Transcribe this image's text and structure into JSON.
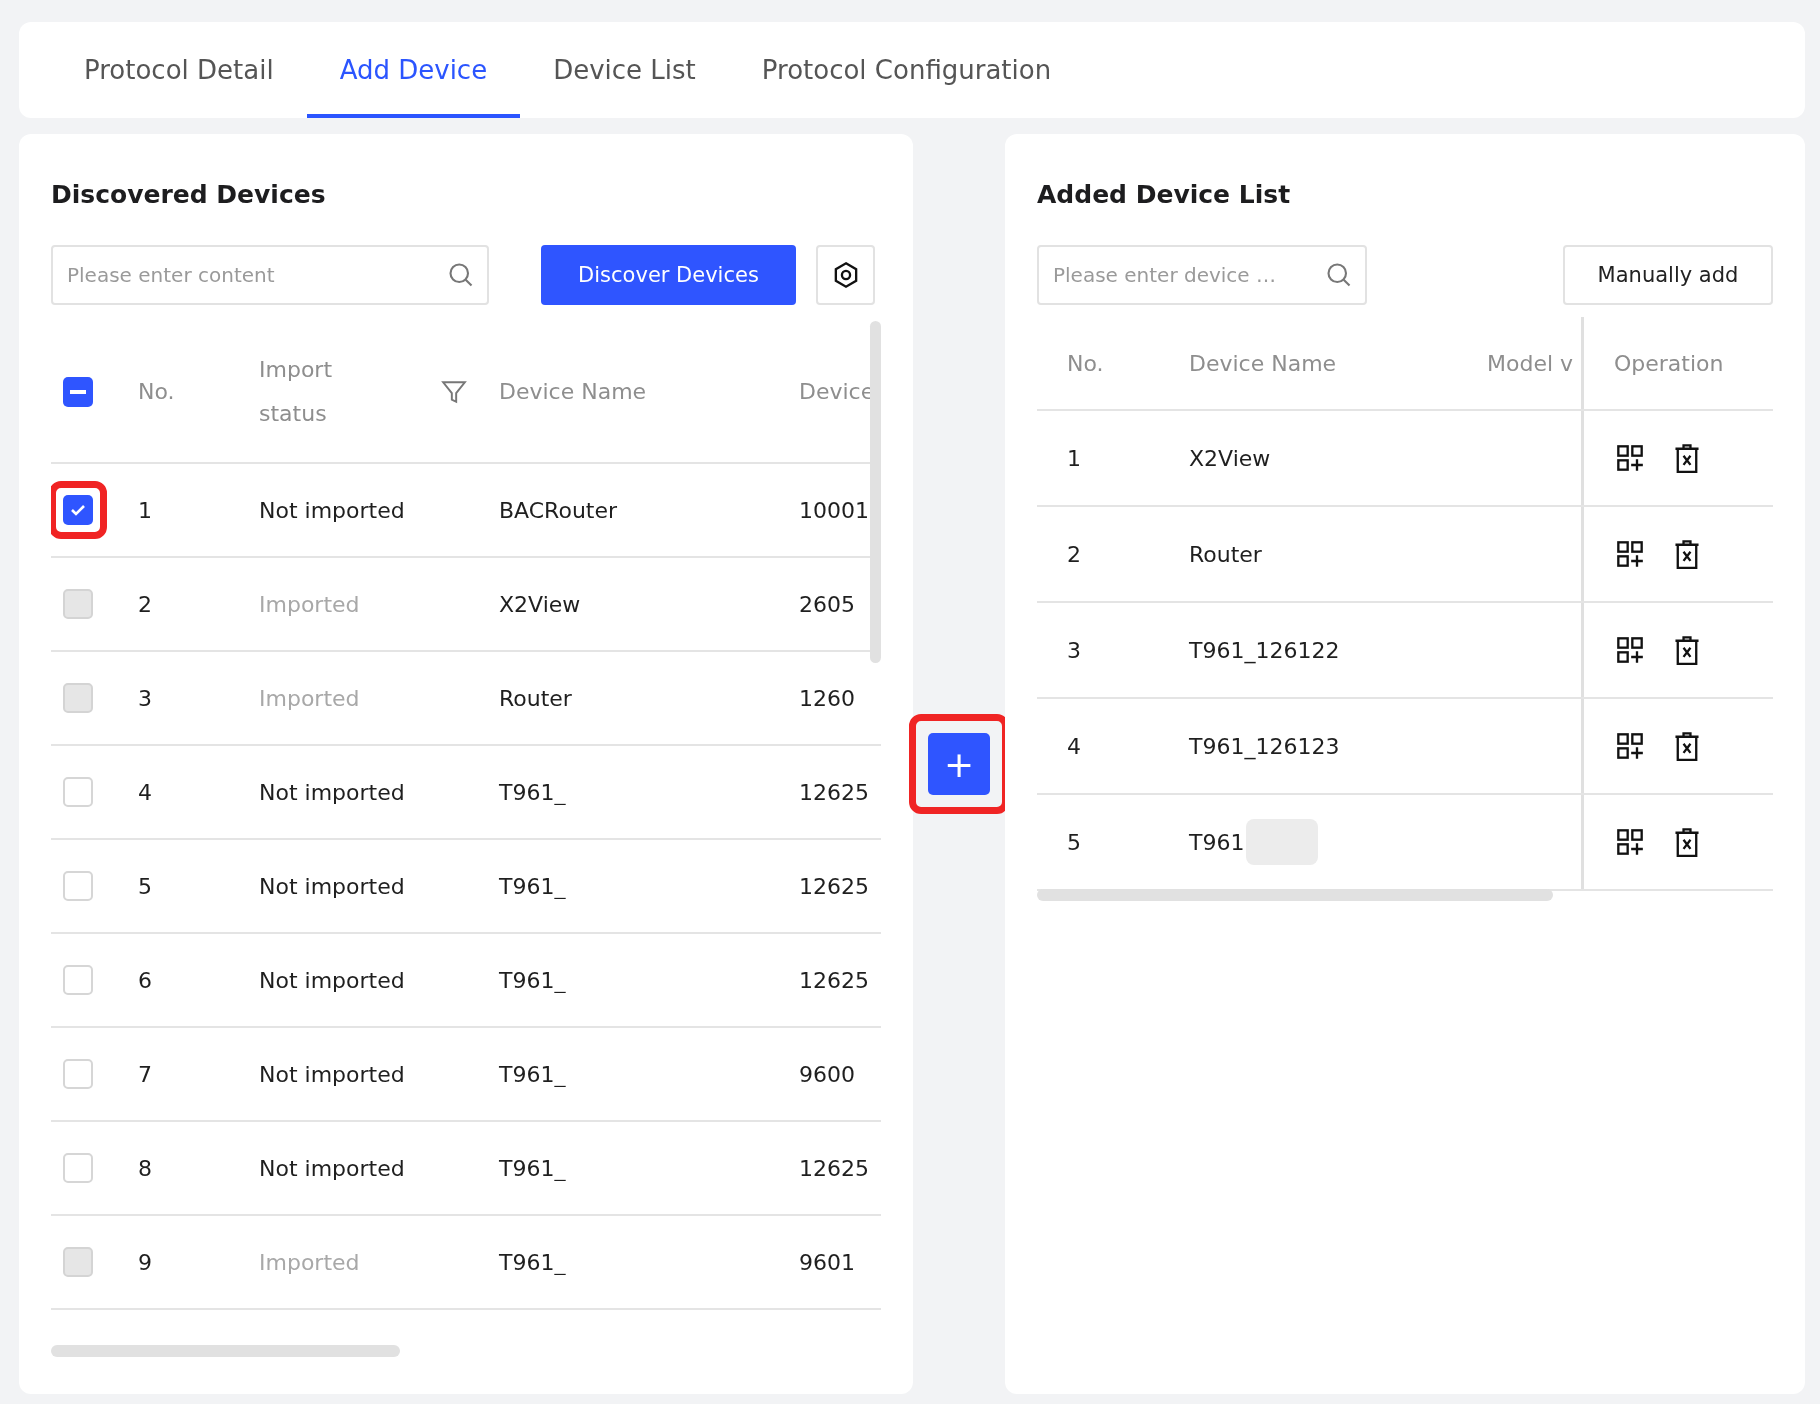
{
  "tabs": [
    {
      "label": "Protocol Detail",
      "selected": false
    },
    {
      "label": "Add Device",
      "selected": true
    },
    {
      "label": "Device List",
      "selected": false
    },
    {
      "label": "Protocol Configuration",
      "selected": false
    }
  ],
  "discovered": {
    "title": "Discovered Devices",
    "search": {
      "placeholder": "Please enter content"
    },
    "discover_button": "Discover Devices",
    "columns": [
      "No.",
      "Import status",
      "Device Name",
      "Device"
    ],
    "select_all": {
      "indeterminate": true
    },
    "rows": [
      {
        "no": "1",
        "status": "Not imported",
        "name": "BACRouter",
        "device": "10001",
        "checked": true,
        "disabled": false,
        "highlighted": true
      },
      {
        "no": "2",
        "status": "Imported",
        "name": "X2View",
        "device": "2605",
        "checked": false,
        "disabled": true,
        "highlighted": false
      },
      {
        "no": "3",
        "status": "Imported",
        "name": "Router",
        "device": "1260",
        "checked": false,
        "disabled": true,
        "highlighted": false
      },
      {
        "no": "4",
        "status": "Not imported",
        "name": "T961_",
        "device": "12625",
        "checked": false,
        "disabled": false,
        "highlighted": false
      },
      {
        "no": "5",
        "status": "Not imported",
        "name": "T961_",
        "device": "12625",
        "checked": false,
        "disabled": false,
        "highlighted": false
      },
      {
        "no": "6",
        "status": "Not imported",
        "name": "T961_",
        "device": "12625",
        "checked": false,
        "disabled": false,
        "highlighted": false
      },
      {
        "no": "7",
        "status": "Not imported",
        "name": "T961_",
        "device": "9600",
        "checked": false,
        "disabled": false,
        "highlighted": false
      },
      {
        "no": "8",
        "status": "Not imported",
        "name": "T961_",
        "device": "12625",
        "checked": false,
        "disabled": false,
        "highlighted": false
      },
      {
        "no": "9",
        "status": "Imported",
        "name": "T961_",
        "device": "9601",
        "checked": false,
        "disabled": true,
        "highlighted": false
      }
    ]
  },
  "transfer_button": {
    "label": "+",
    "highlighted": true
  },
  "added": {
    "title": "Added Device List",
    "search": {
      "placeholder": "Please enter device …"
    },
    "add_button": "Manually add",
    "columns": [
      "No.",
      "Device Name",
      "Model v",
      "Operation"
    ],
    "rows": [
      {
        "no": "1",
        "name": "X2View",
        "redacted": false
      },
      {
        "no": "2",
        "name": "Router",
        "redacted": false
      },
      {
        "no": "3",
        "name": "T961_126122",
        "redacted": false
      },
      {
        "no": "4",
        "name": "T961_126123",
        "redacted": false
      },
      {
        "no": "5",
        "name": "T961",
        "redacted": true
      }
    ]
  }
}
